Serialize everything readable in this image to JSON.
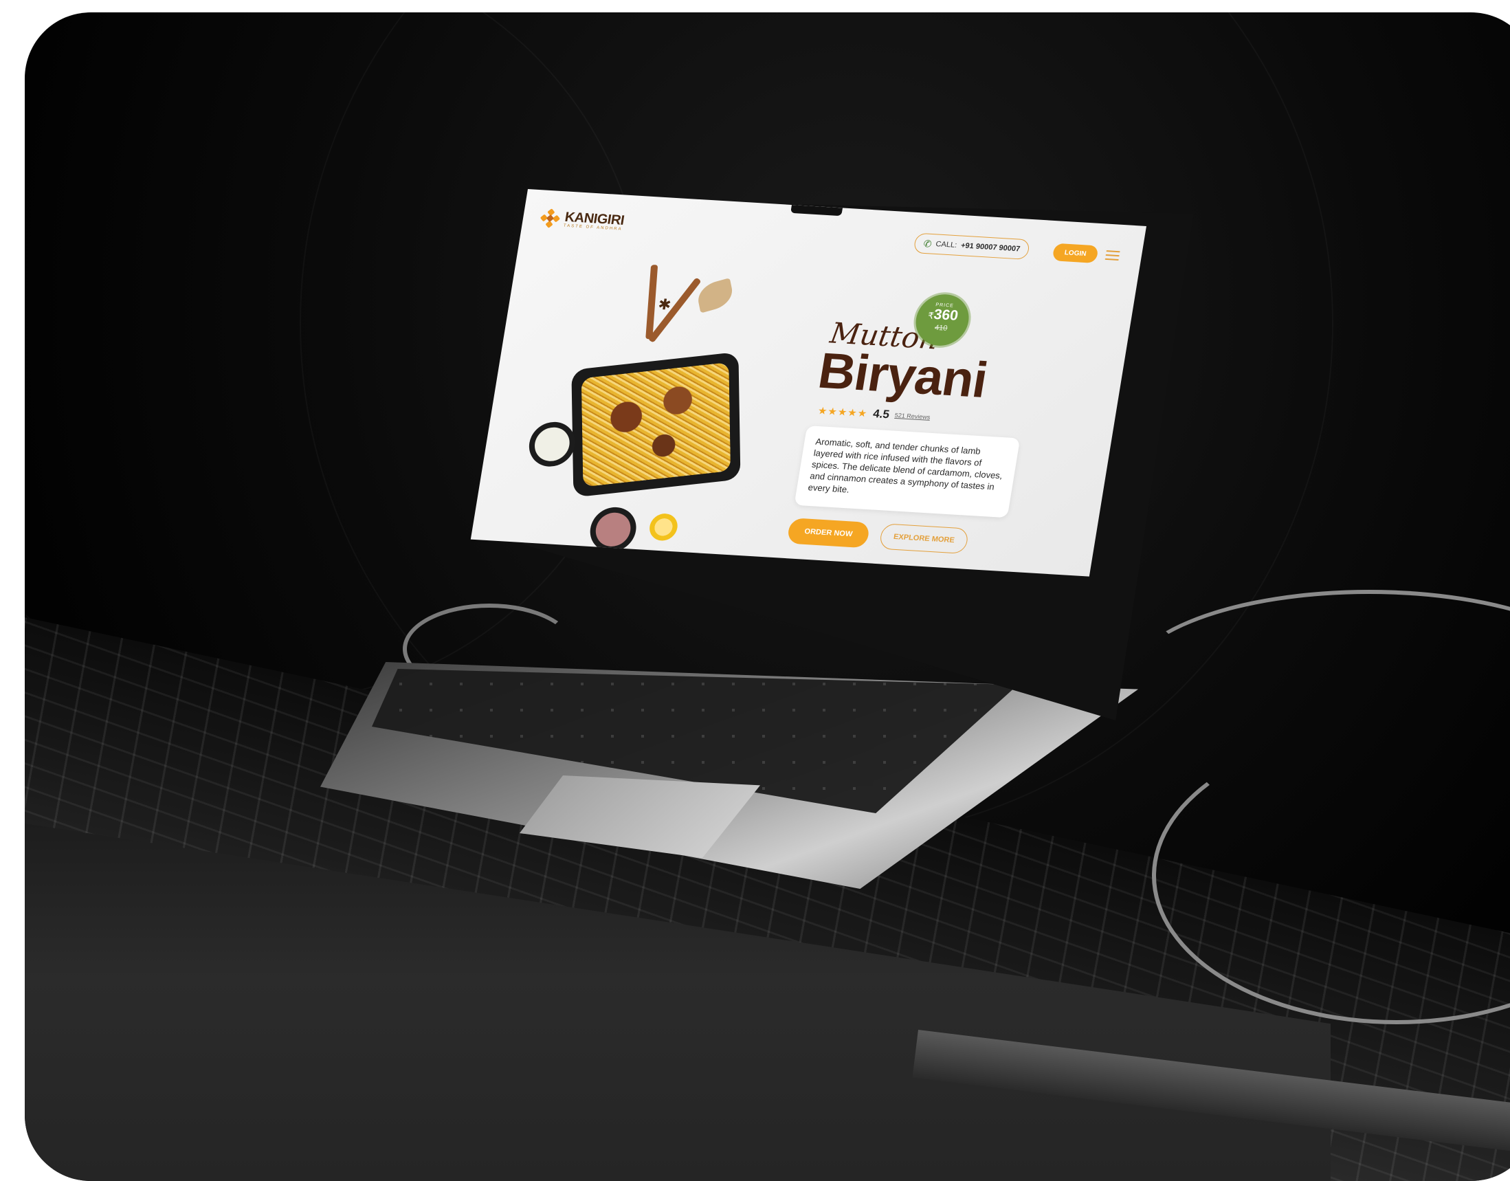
{
  "brand": {
    "name": "KANIGIRI",
    "tagline": "TASTE OF ANDHRA"
  },
  "header": {
    "call_label": "CALL:",
    "call_number": "+91 90007 90007",
    "login_label": "LOGIN"
  },
  "product": {
    "title_script": "Mutton",
    "title_main": "Biryani",
    "price_label": "PRICE",
    "currency": "₹",
    "price_now": "360",
    "price_was": "410",
    "stars": "★★★★★",
    "rating": "4.5",
    "reviews": "521 Reviews",
    "description": "Aromatic, soft, and tender chunks of lamb layered with rice infused with the flavors of spices. The delicate blend of cardamom, cloves, and cinnamon creates a symphony of tastes in every bite."
  },
  "actions": {
    "order_label": "ORDER NOW",
    "explore_label": "EXPLORE MORE"
  },
  "icons": {
    "phone": "phone-icon",
    "menu": "hamburger-menu-icon",
    "logo": "logo-mark-icon"
  },
  "colors": {
    "accent": "#f5a623",
    "brown": "#4a2210",
    "green": "#6e9b3e"
  }
}
